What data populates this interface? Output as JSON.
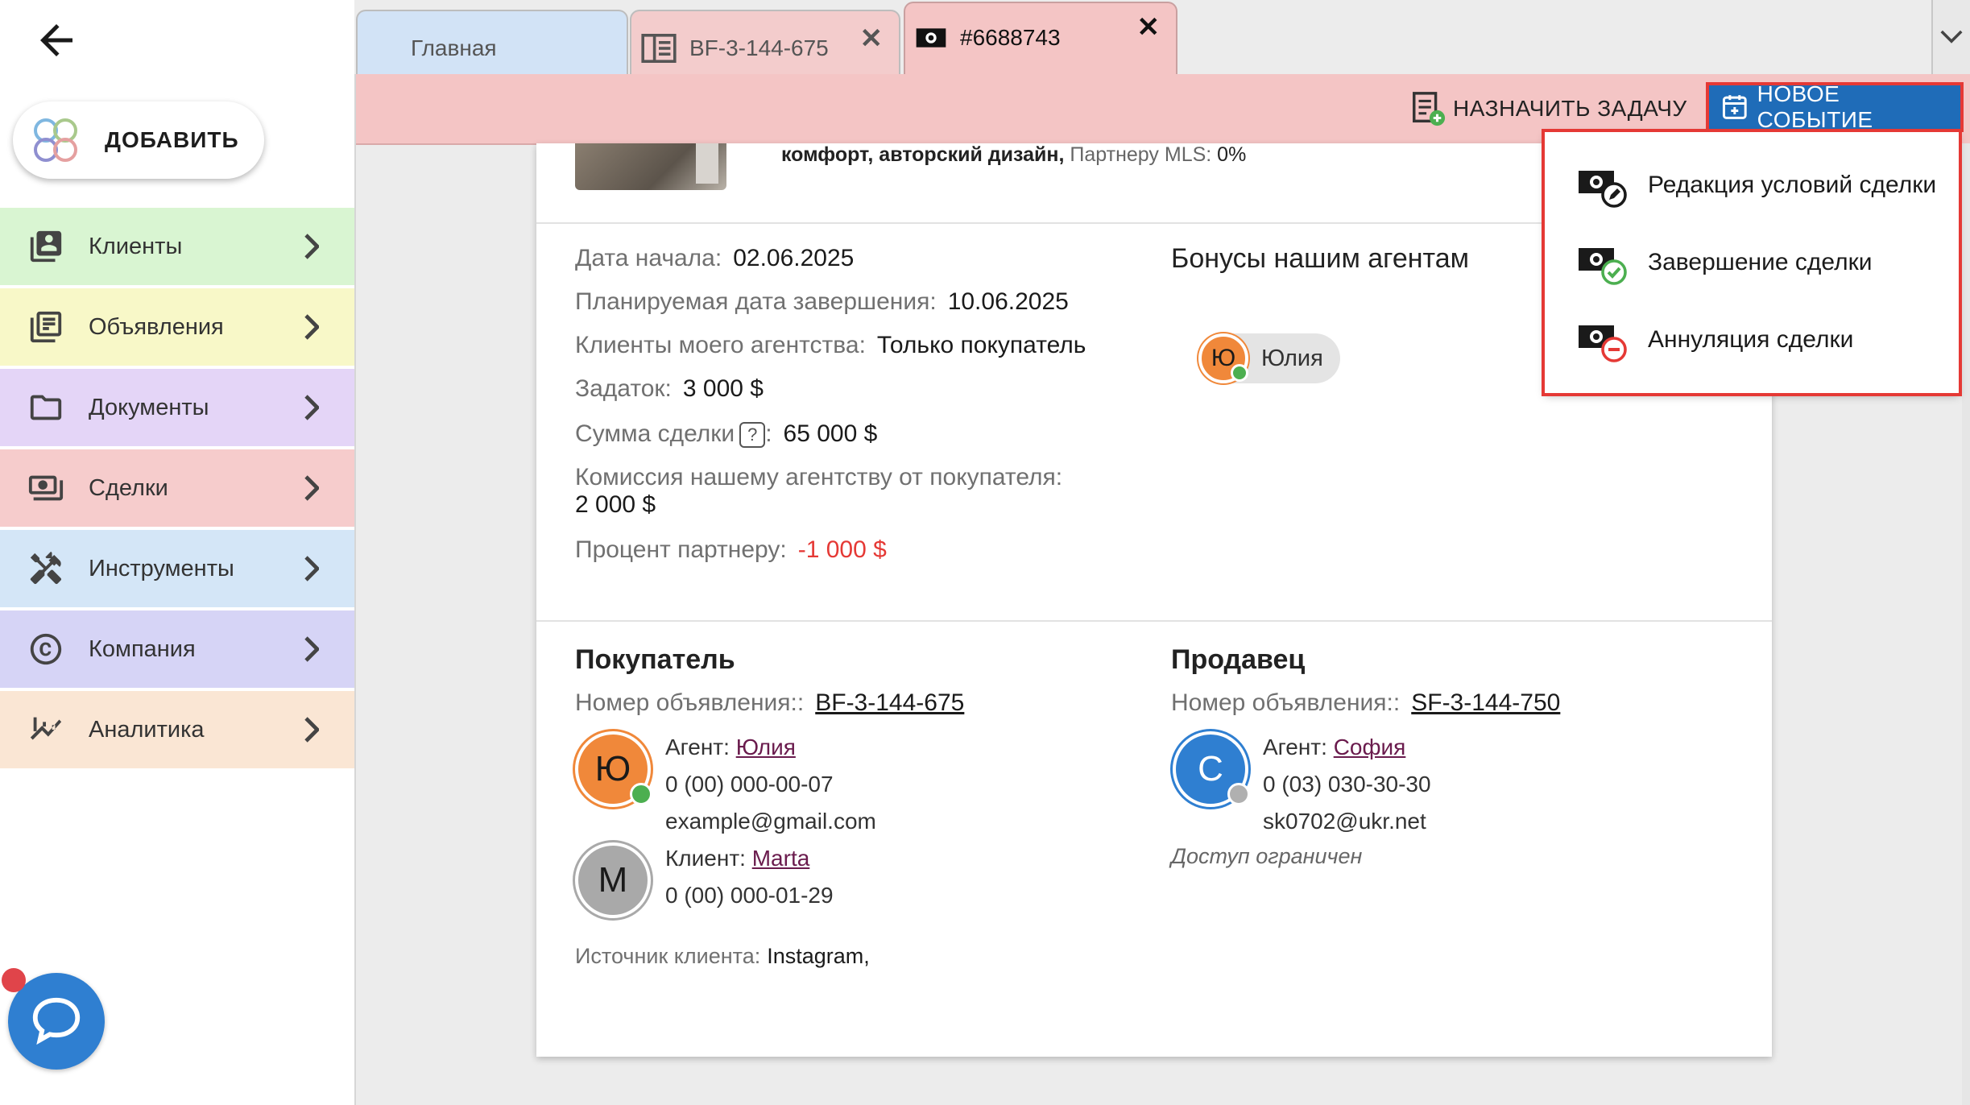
{
  "sidebar": {
    "add_label": "ДОБАВИТЬ",
    "items": [
      {
        "label": "Клиенты",
        "icon": "clients-icon",
        "color": "#d9f5d2"
      },
      {
        "label": "Объявления",
        "icon": "listings-icon",
        "color": "#f8f8c8"
      },
      {
        "label": "Документы",
        "icon": "folder-icon",
        "color": "#e4d5f7"
      },
      {
        "label": "Сделки",
        "icon": "deals-icon",
        "color": "#f6cccc"
      },
      {
        "label": "Инструменты",
        "icon": "tools-icon",
        "color": "#d4e6f7"
      },
      {
        "label": "Компания",
        "icon": "copyright-icon",
        "color": "#d6d4f6"
      },
      {
        "label": "Аналитика",
        "icon": "analytics-icon",
        "color": "#fae6d4"
      }
    ]
  },
  "tabs": [
    {
      "label": "Главная"
    },
    {
      "label": "BF-3-144-675",
      "close": "✕"
    },
    {
      "label": "#6688743",
      "close": "✕"
    }
  ],
  "actions": {
    "assign_task": "НАЗНАЧИТЬ ЗАДАЧУ",
    "new_event": "НОВОЕ СОБЫТИЕ"
  },
  "dropdown": [
    {
      "label": "Редакция условий сделки"
    },
    {
      "label": "Завершение сделки"
    },
    {
      "label": "Аннуляция сделки"
    }
  ],
  "listing": {
    "desc_bold": "комфорт, авторский дизайн, ",
    "partner_label": "Партнеру MLS: ",
    "partner_value": "0%"
  },
  "deal": {
    "start_label": "Дата начала:",
    "start_value": "02.06.2025",
    "planned_label": "Планируемая дата завершения:",
    "planned_value": "10.06.2025",
    "clients_label": "Клиенты моего агентства:",
    "clients_value": "Только покупатель",
    "deposit_label": "Задаток:",
    "deposit_value": "3 000 $",
    "sum_label": "Сумма сделки",
    "sum_help": "?",
    "sum_colon": ":",
    "sum_value": "65 000 $",
    "commission_label": "Комиссия нашему агентству от покупателя:",
    "commission_value": "2 000 $",
    "partner_pct_label": "Процент партнеру:",
    "partner_pct_value": "-1 000 $"
  },
  "bonuses": {
    "title": "Бонусы нашим агентам",
    "agent_initial": "Ю",
    "agent_name": "Юлия"
  },
  "buyer": {
    "title": "Покупатель",
    "listing_label": "Номер объявления::",
    "listing_no": "BF-3-144-675",
    "agent_initial": "Ю",
    "agent_label": "Агент:",
    "agent_name": "Юлия",
    "agent_phone": "0 (00) 000-00-07",
    "agent_email": "example@gmail.com",
    "client_initial": "M",
    "client_label": "Клиент:",
    "client_name": "Marta",
    "client_phone": "0 (00) 000-01-29",
    "source_label": "Источник клиента:",
    "source_value": "Instagram,"
  },
  "seller": {
    "title": "Продавец",
    "listing_label": "Номер объявления::",
    "listing_no": "SF-3-144-750",
    "agent_initial": "С",
    "agent_label": "Агент:",
    "agent_name": "София",
    "agent_phone": "0 (03) 030-30-30",
    "agent_email": "sk0702@ukr.net",
    "restricted": "Доступ ограничен"
  },
  "colors": {
    "accent_blue": "#1f6cb8",
    "highlight_red": "#e53935",
    "deal_pink": "#f4c5c5",
    "avatar_orange": "#f0883a",
    "avatar_blue": "#2f7fd1",
    "online_green": "#4caf50"
  }
}
